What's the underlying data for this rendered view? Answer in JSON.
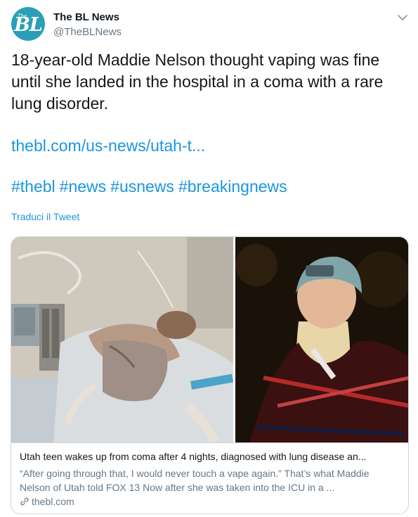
{
  "account": {
    "avatar_text": "BL",
    "avatar_small_text": "The",
    "display_name": "The BL News",
    "handle": "@TheBLNews"
  },
  "tweet": {
    "text": "18-year-old Maddie Nelson thought vaping was fine until she landed in the hospital in a coma with a rare lung disorder.",
    "link": "thebl.com/us-news/utah-t...",
    "hashtags": [
      "#thebl",
      "#news",
      "#usnews",
      "#breakingnews"
    ],
    "translate_label": "Traduci il Tweet"
  },
  "card": {
    "title": "Utah teen wakes up from coma after 4 nights, diagnosed with lung disease an...",
    "description": "“After going through that, I would never touch a vape again.” That’s what Maddie Nelson of Utah told FOX 13 Now after she was taken into the ICU in a ...",
    "domain": "thebl.com"
  },
  "icons": {
    "menu": "chevron-down-icon",
    "domain": "link-icon"
  },
  "colors": {
    "link": "#1b95e0",
    "secondary_text": "#657786",
    "avatar_bg": "#2a9fb7",
    "border": "#ccd6dd"
  }
}
